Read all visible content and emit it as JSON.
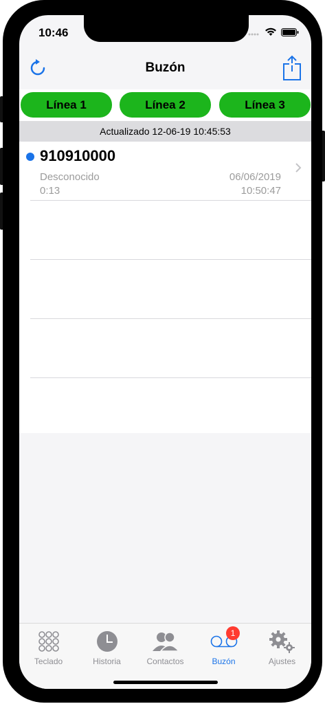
{
  "status_bar": {
    "time": "10:46"
  },
  "nav": {
    "title": "Buzón",
    "refresh_icon": "refresh-icon",
    "share_icon": "share-icon"
  },
  "line_buttons": [
    {
      "label": "Línea 1"
    },
    {
      "label": "Línea 2"
    },
    {
      "label": "Línea 3"
    }
  ],
  "updated_text": "Actualizado 12-06-19 10:45:53",
  "voicemails": [
    {
      "number": "910910000",
      "name": "Desconocido",
      "duration": "0:13",
      "date": "06/06/2019",
      "time": "10:50:47",
      "unread": true
    }
  ],
  "tabs": [
    {
      "label": "Teclado",
      "icon": "keypad-icon",
      "active": false
    },
    {
      "label": "Historia",
      "icon": "clock-icon",
      "active": false
    },
    {
      "label": "Contactos",
      "icon": "contacts-icon",
      "active": false
    },
    {
      "label": "Buzón",
      "icon": "voicemail-icon",
      "active": true,
      "badge": "1"
    },
    {
      "label": "Ajustes",
      "icon": "settings-icon",
      "active": false
    }
  ],
  "colors": {
    "accent": "#1a73e8",
    "line_button": "#1cb51c",
    "badge": "#ff3b30",
    "unread_dot": "#1a73e8"
  }
}
